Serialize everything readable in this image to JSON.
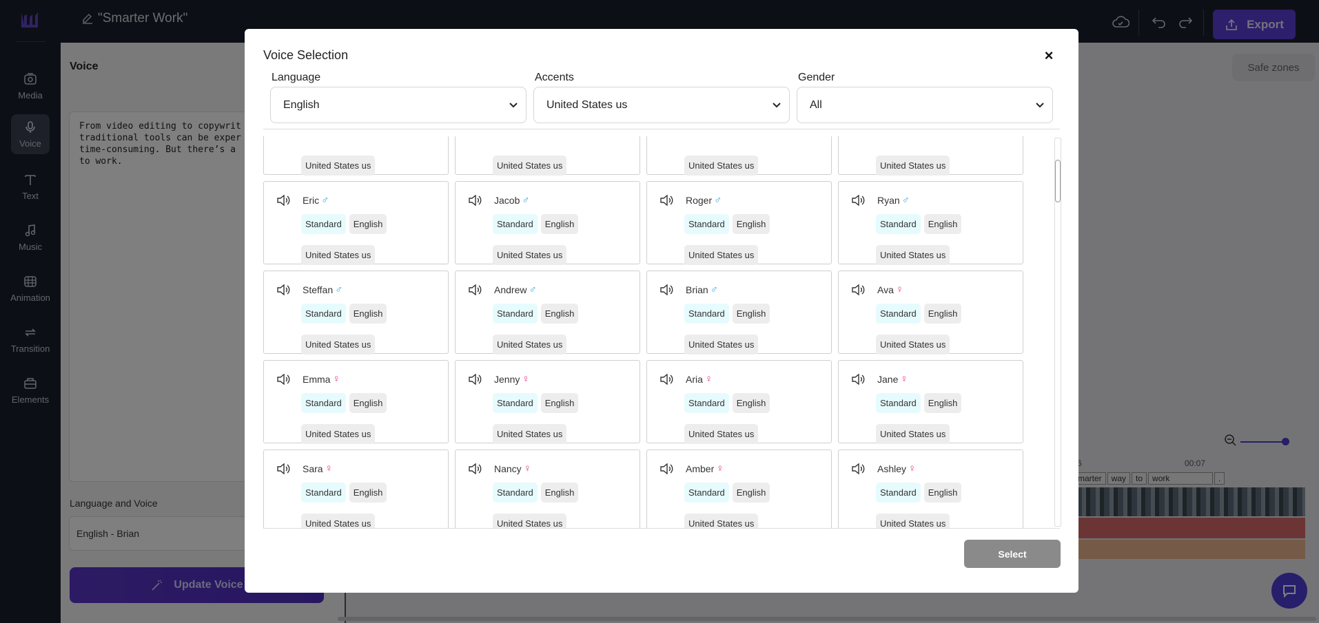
{
  "app": {
    "project_title": "\"Smarter Work\"",
    "export_label": "Export",
    "safe_zones_label": "Safe zones"
  },
  "sidebar": {
    "items": [
      {
        "label": "Media",
        "icon": "media-icon"
      },
      {
        "label": "Voice",
        "icon": "microphone-icon",
        "active": true
      },
      {
        "label": "Text",
        "icon": "text-icon"
      },
      {
        "label": "Music",
        "icon": "music-icon"
      },
      {
        "label": "Animation",
        "icon": "animation-icon"
      },
      {
        "label": "Transition",
        "icon": "transition-icon"
      },
      {
        "label": "Elements",
        "icon": "elements-icon"
      }
    ]
  },
  "voice_panel": {
    "title": "Voice",
    "script_text": "From video editing to copywrit\ntraditional tools can be exper\ntime-consuming. But there’s a \nto work.",
    "language_voice_label": "Language and Voice",
    "language_voice_value": "English - Brian",
    "update_button": "Update Voice"
  },
  "timeline": {
    "time_a": "6",
    "time_b": "00:07",
    "time_c": "00",
    "words": [
      "marter",
      "way",
      "to",
      "work",
      "."
    ]
  },
  "modal": {
    "title": "Voice Selection",
    "close": "×",
    "select_button": "Select",
    "filters": {
      "language": {
        "label": "Language",
        "value": "English"
      },
      "accents": {
        "label": "Accents",
        "value": "United States us"
      },
      "gender": {
        "label": "Gender",
        "value": "All"
      }
    },
    "voices": [
      {
        "name": "",
        "gender": "",
        "quality": "",
        "language": "",
        "accent": "United States us"
      },
      {
        "name": "",
        "gender": "",
        "quality": "",
        "language": "",
        "accent": "United States us"
      },
      {
        "name": "",
        "gender": "",
        "quality": "",
        "language": "",
        "accent": "United States us"
      },
      {
        "name": "",
        "gender": "",
        "quality": "",
        "language": "",
        "accent": "United States us"
      },
      {
        "name": "Eric",
        "gender": "male",
        "quality": "Standard",
        "language": "English",
        "accent": "United States us"
      },
      {
        "name": "Jacob",
        "gender": "male",
        "quality": "Standard",
        "language": "English",
        "accent": "United States us"
      },
      {
        "name": "Roger",
        "gender": "male",
        "quality": "Standard",
        "language": "English",
        "accent": "United States us"
      },
      {
        "name": "Ryan",
        "gender": "male",
        "quality": "Standard",
        "language": "English",
        "accent": "United States us"
      },
      {
        "name": "Steffan",
        "gender": "male",
        "quality": "Standard",
        "language": "English",
        "accent": "United States us"
      },
      {
        "name": "Andrew",
        "gender": "male",
        "quality": "Standard",
        "language": "English",
        "accent": "United States us"
      },
      {
        "name": "Brian",
        "gender": "male",
        "quality": "Standard",
        "language": "English",
        "accent": "United States us"
      },
      {
        "name": "Ava",
        "gender": "female",
        "quality": "Standard",
        "language": "English",
        "accent": "United States us"
      },
      {
        "name": "Emma",
        "gender": "female",
        "quality": "Standard",
        "language": "English",
        "accent": "United States us"
      },
      {
        "name": "Jenny",
        "gender": "female",
        "quality": "Standard",
        "language": "English",
        "accent": "United States us"
      },
      {
        "name": "Aria",
        "gender": "female",
        "quality": "Standard",
        "language": "English",
        "accent": "United States us"
      },
      {
        "name": "Jane",
        "gender": "female",
        "quality": "Standard",
        "language": "English",
        "accent": "United States us"
      },
      {
        "name": "Sara",
        "gender": "female",
        "quality": "Standard",
        "language": "English",
        "accent": "United States us"
      },
      {
        "name": "Nancy",
        "gender": "female",
        "quality": "Standard",
        "language": "English",
        "accent": "United States us"
      },
      {
        "name": "Amber",
        "gender": "female",
        "quality": "Standard",
        "language": "English",
        "accent": "United States us"
      },
      {
        "name": "Ashley",
        "gender": "female",
        "quality": "Standard",
        "language": "English",
        "accent": "United States us"
      }
    ]
  }
}
